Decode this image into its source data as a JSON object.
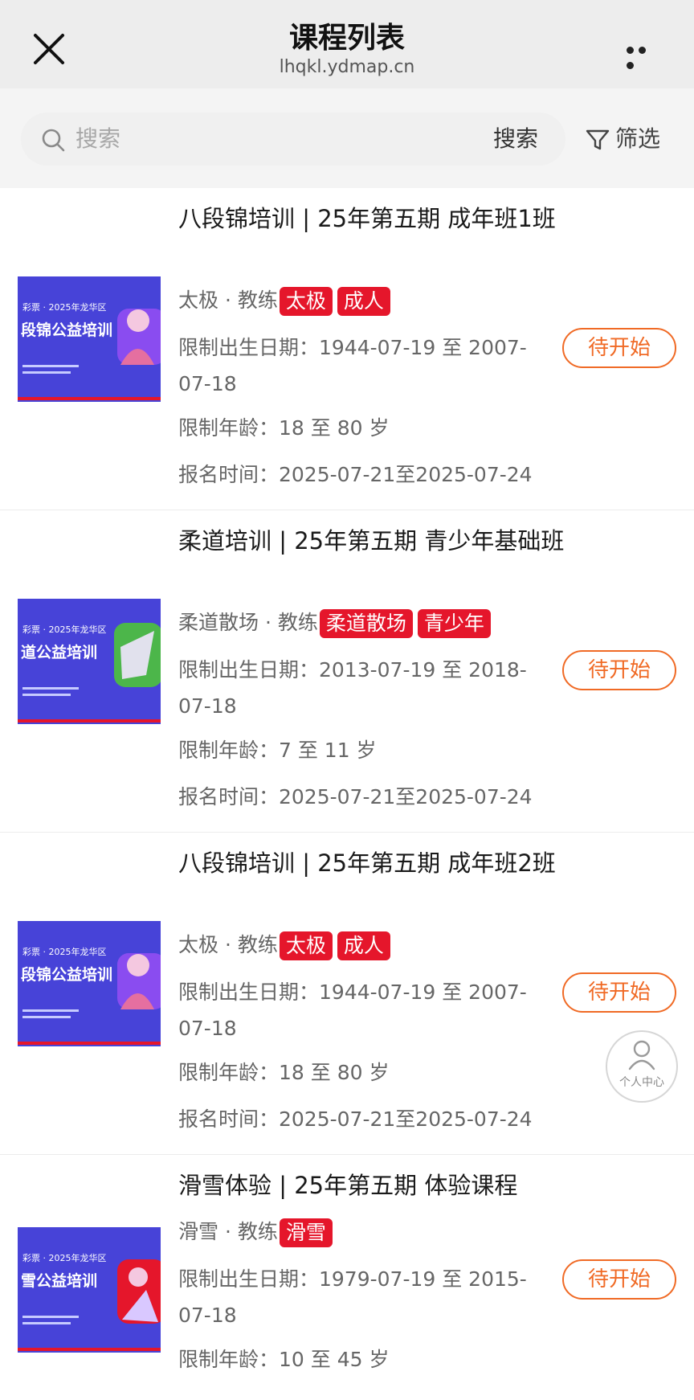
{
  "header": {
    "title": "课程列表",
    "domain": "lhqkl.ydmap.cn",
    "close_icon": "close-icon",
    "more_icon": "more-dots-icon"
  },
  "search": {
    "placeholder": "搜索",
    "button_label": "搜索",
    "filter_label": "筛选"
  },
  "colors": {
    "accent": "#f06a25",
    "tag": "#e5162b",
    "banner": "#3b46d8"
  },
  "courses": [
    {
      "title": "八段锦培训 | 25年第五期 成年班1班",
      "category": "太极",
      "coach_label": "教练",
      "tags": [
        "太极",
        "成人"
      ],
      "birth_range": "限制出生日期：1944-07-19 至 2007-07-18",
      "age_range": "限制年龄：18 至 80 岁",
      "signup_time": "报名时间：2025-07-21至2025-07-24",
      "status": "待开始",
      "thumb_text": "段锦公益培训",
      "thumb_small": "彩票 · 2025年龙华区"
    },
    {
      "title": "柔道培训 | 25年第五期 青少年基础班",
      "category": "柔道散场",
      "coach_label": "教练",
      "tags": [
        "柔道散场",
        "青少年"
      ],
      "birth_range": "限制出生日期：2013-07-19 至 2018-07-18",
      "age_range": "限制年龄：7 至 11 岁",
      "signup_time": "报名时间：2025-07-21至2025-07-24",
      "status": "待开始",
      "thumb_text": "道公益培训",
      "thumb_small": "彩票 · 2025年龙华区"
    },
    {
      "title": "八段锦培训 | 25年第五期 成年班2班",
      "category": "太极",
      "coach_label": "教练",
      "tags": [
        "太极",
        "成人"
      ],
      "birth_range": "限制出生日期：1944-07-19 至 2007-07-18",
      "age_range": "限制年龄：18 至 80 岁",
      "signup_time": "报名时间：2025-07-21至2025-07-24",
      "status": "待开始",
      "thumb_text": "段锦公益培训",
      "thumb_small": "彩票 · 2025年龙华区"
    },
    {
      "title": "滑雪体验 | 25年第五期 体验课程",
      "category": "滑雪",
      "coach_label": "教练",
      "tags": [
        "滑雪"
      ],
      "birth_range": "限制出生日期：1979-07-19 至 2015-07-18",
      "age_range": "限制年龄：10 至 45 岁",
      "signup_time": "",
      "status": "待开始",
      "thumb_text": "雪公益培训",
      "thumb_small": "彩票 · 2025年龙华区"
    }
  ],
  "fab": {
    "label": "个人中心",
    "icon": "user-icon"
  }
}
